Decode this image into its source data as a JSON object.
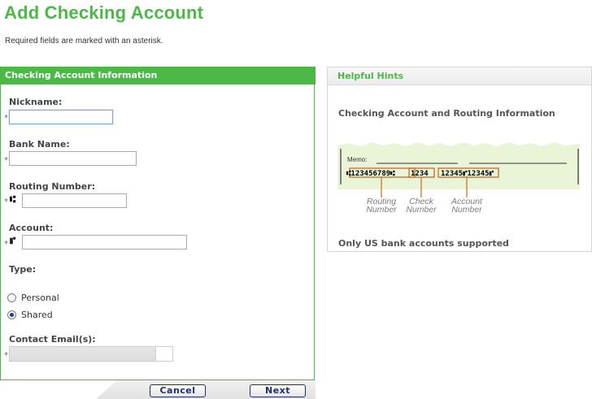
{
  "page": {
    "title": "Add Checking Account",
    "required_note": "Required fields are marked with an asterisk."
  },
  "form": {
    "header": "Checking Account Information",
    "required_mark": "*",
    "fields": {
      "nickname": {
        "label": "Nickname:",
        "value": ""
      },
      "bank_name": {
        "label": "Bank Name:",
        "value": ""
      },
      "routing_number": {
        "label": "Routing Number:",
        "value": "",
        "micr_symbol": "⑆"
      },
      "account": {
        "label": "Account:",
        "value": "",
        "micr_symbol": "⑈"
      },
      "type": {
        "label": "Type:",
        "options": [
          "Personal",
          "Shared"
        ],
        "selected": "Shared"
      },
      "contact_emails": {
        "label": "Contact Email(s):",
        "value": ""
      }
    },
    "buttons": {
      "cancel": "Cancel",
      "next": "Next"
    }
  },
  "hints": {
    "header": "Helpful Hints",
    "subtitle": "Checking Account and Routing Information",
    "check_image": {
      "memo_label": "Memo:",
      "routing_micr": "⑆123456789⑆",
      "check_micr": "1234",
      "account_micr": "12345⑈12345⑈",
      "captions": {
        "routing": [
          "Routing",
          "Number"
        ],
        "check": [
          "Check",
          "Number"
        ],
        "account": [
          "Account",
          "Number"
        ]
      }
    },
    "footer": "Only US bank accounts supported"
  },
  "colors": {
    "accent_green": "#4cb848",
    "button_navy": "#1f2f6b",
    "check_paper": "#eaf5d8",
    "check_highlight": "#c96a1e"
  }
}
